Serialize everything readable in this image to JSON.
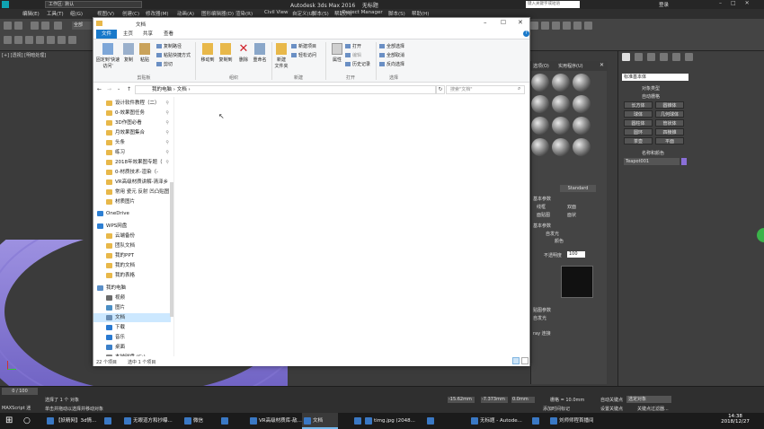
{
  "max": {
    "title": "Autodesk 3ds Max 2016",
    "file_title": "无标题",
    "workspace": "工作区: 默认",
    "search_placeholder": "键入关键字或短语",
    "login": "登录",
    "menus": [
      "编辑(E)",
      "工具(T)",
      "组(G)",
      "视图(V)",
      "创建(C)",
      "修改器(M)",
      "动画(A)",
      "图形编辑器(D)",
      "渲染(R)",
      "Civil View",
      "自定义(U)",
      "脚本(S)",
      "帮助(H)",
      "Project Manager",
      "脚本(S)",
      "帮助(H)"
    ],
    "viewport_label": "[+] [透视] [明暗处理]",
    "timeline": "0 / 100",
    "status_line1": "选择了 1 个 对象",
    "status_line2": "单击并拖动以选择并移动对象",
    "coord_x": "-15.62mm",
    "coord_y": "-7.373mm",
    "coord_z": "0.0mm",
    "grid": "栅格 = 10.0mm",
    "add_time_tag": "添加时间标记",
    "auto_key": "自动关键点",
    "selected_obj": "选定对象",
    "set_key": "设置关键点",
    "key_filters": "关键点过滤器...",
    "maxscript": "MAXScript 迷",
    "mat_tabs": [
      "选项(O)",
      "实用程序(U)"
    ],
    "mat_standard": "Standard",
    "mat_labels": [
      "基本参数",
      "线框",
      "双面",
      "面贴图",
      "面状",
      "基本参数",
      "自发光",
      "颜色",
      "不透明度",
      "100",
      "贴图参数",
      "自发光",
      "ray 连接"
    ],
    "cmd": {
      "dropdown": "标准基本体",
      "rollout": "对象类型",
      "autogrid": "自动栅格",
      "buttons": [
        "长方体",
        "圆锥体",
        "球体",
        "几何球体",
        "圆柱体",
        "管状体",
        "圆环",
        "四棱锥",
        "茶壶",
        "平面"
      ],
      "name_rollout": "名称和颜色",
      "name_value": "Teapot001",
      "accent": "#8a6fd8"
    }
  },
  "explorer": {
    "title": "文档",
    "tabs": [
      "文件",
      "主页",
      "共享",
      "查看"
    ],
    "ribbon": {
      "clipboard": {
        "pin": "固定到'快速访问'",
        "copy": "复制",
        "paste": "粘贴",
        "copy_path": "复制路径",
        "paste_shortcut": "粘贴快捷方式",
        "cut": "剪切",
        "label": "剪贴板"
      },
      "organize": {
        "move_to": "移动到",
        "copy_to": "复制到",
        "delete": "删除",
        "rename": "重命名",
        "label": "组织"
      },
      "new": {
        "new_folder": "新建\n文件夹",
        "new_item": "新建项目",
        "easy_access": "轻松访问",
        "label": "新建"
      },
      "open": {
        "properties": "属性",
        "open": "打开",
        "edit": "编辑",
        "history": "历史记录",
        "label": "打开"
      },
      "select": {
        "all": "全部选择",
        "none": "全部取消",
        "invert": "反向选择",
        "label": "选择"
      }
    },
    "breadcrumb": [
      "我的电脑",
      "文档"
    ],
    "search_placeholder": "搜索\"文档\"",
    "nav_items": [
      {
        "label": "设计软件教程（二）",
        "type": "folder",
        "pin": true
      },
      {
        "label": "0-效果图任务",
        "type": "folder",
        "pin": true
      },
      {
        "label": "3D作图必看",
        "type": "folder",
        "pin": true
      },
      {
        "label": "月效果图集合",
        "type": "folder",
        "pin": true
      },
      {
        "label": "头条",
        "type": "folder",
        "pin": true
      },
      {
        "label": "练习",
        "type": "folder",
        "pin": true
      },
      {
        "label": "2018年效果图专题（",
        "type": "folder",
        "pin": true
      },
      {
        "label": "0-材质技术-渲染（-",
        "type": "folder",
        "pin": false
      },
      {
        "label": "VR高级材质讲解-清泽乡（",
        "type": "folder",
        "pin": false
      },
      {
        "label": "常用 瓷元 反射 凹凸贴图",
        "type": "folder",
        "pin": false
      },
      {
        "label": "材质图片",
        "type": "folder",
        "pin": false
      },
      {
        "label": "OneDrive",
        "type": "cloud",
        "pin": false
      },
      {
        "label": "WPS网盘",
        "type": "cloud",
        "pin": false
      },
      {
        "label": "云端备份",
        "type": "folder",
        "pin": false
      },
      {
        "label": "团队文档",
        "type": "folder",
        "pin": false
      },
      {
        "label": "我的PPT",
        "type": "folder",
        "pin": false
      },
      {
        "label": "我的文档",
        "type": "folder",
        "pin": false
      },
      {
        "label": "我的表格",
        "type": "folder",
        "pin": false
      },
      {
        "label": "我的电脑",
        "type": "pc",
        "pin": false
      },
      {
        "label": "视频",
        "type": "video",
        "pin": false
      },
      {
        "label": "图片",
        "type": "pic",
        "pin": false
      },
      {
        "label": "文档",
        "type": "doc",
        "pin": false,
        "selected": true
      },
      {
        "label": "下载",
        "type": "down",
        "pin": false
      },
      {
        "label": "音乐",
        "type": "music",
        "pin": false
      },
      {
        "label": "桌面",
        "type": "desk",
        "pin": false
      },
      {
        "label": "本地磁盘 (C:)",
        "type": "drive",
        "pin": false
      }
    ],
    "status_count": "22 个项目",
    "status_selected": "选中 1 个项目"
  },
  "taskbar": {
    "items": [
      "【妖精网】3d情...",
      "",
      "无眼道方和抄曝...",
      "微信",
      "",
      "VR高级材质库-敌...",
      "文档",
      "",
      "timg.jpg (2048...",
      "",
      "无标题 - Autode...",
      "",
      "刘师师程首播间"
    ],
    "time": "14:38",
    "date": "2018/12/27"
  }
}
